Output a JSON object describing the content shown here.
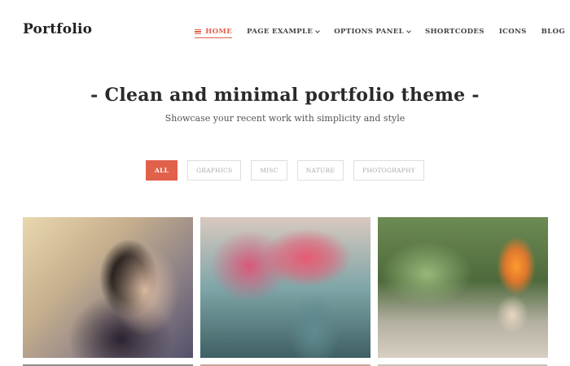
{
  "site": {
    "logo": "Portfolio"
  },
  "nav": {
    "items": [
      {
        "label": "HOME",
        "active": true,
        "icon": "menu-icon"
      },
      {
        "label": "PAGE EXAMPLE",
        "dropdown": true
      },
      {
        "label": "OPTIONS PANEL",
        "dropdown": true
      },
      {
        "label": "SHORTCODES"
      },
      {
        "label": "ICONS"
      },
      {
        "label": "BLOG"
      }
    ]
  },
  "hero": {
    "title": "- Clean and minimal portfolio theme -",
    "subtitle": "Showcase your recent work with simplicity and style"
  },
  "filters": {
    "items": [
      {
        "label": "ALL",
        "active": true
      },
      {
        "label": "GRAPHICS"
      },
      {
        "label": "MISC"
      },
      {
        "label": "NATURE"
      },
      {
        "label": "PHOTOGRAPHY"
      }
    ]
  },
  "gallery": {
    "items": [
      {
        "subject": "woman-hair-photo"
      },
      {
        "subject": "pink-tree-photo"
      },
      {
        "subject": "paint-splash-cup-photo"
      }
    ]
  },
  "colors": {
    "accent": "#e2614b",
    "text": "#2a2a2a",
    "muted": "#aaaaaa"
  }
}
